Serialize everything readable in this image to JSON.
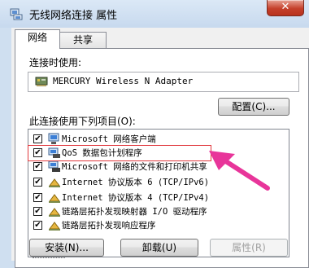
{
  "window": {
    "title": "无线网络连接 属性",
    "close_glyph": "✕"
  },
  "tabs": [
    {
      "label": "网络"
    },
    {
      "label": "共享"
    }
  ],
  "connect_using": {
    "label": "连接时使用:",
    "adapter": "MERCURY Wireless N Adapter",
    "icon": "network-adapter-icon"
  },
  "configure_button": "配置(C)...",
  "items_label": "此连接使用下列项目(O):",
  "items": [
    {
      "label": "Microsoft 网络客户端",
      "checked": true,
      "icon": "network-client-icon"
    },
    {
      "label": "QoS 数据包计划程序",
      "checked": true,
      "icon": "qos-scheduler-icon"
    },
    {
      "label": "Microsoft 网络的文件和打印机共享",
      "checked": true,
      "icon": "file-printer-sharing-icon"
    },
    {
      "label": "Internet 协议版本 6 (TCP/IPv6)",
      "checked": true,
      "icon": "protocol-icon",
      "highlighted": true
    },
    {
      "label": "Internet 协议版本 4 (TCP/IPv4)",
      "checked": true,
      "icon": "protocol-icon"
    },
    {
      "label": "链路层拓扑发现映射器 I/O 驱动程序",
      "checked": true,
      "icon": "protocol-icon"
    },
    {
      "label": "链路层拓扑发现响应程序",
      "checked": true,
      "icon": "protocol-icon"
    }
  ],
  "buttons": {
    "install": "安装(N)...",
    "uninstall": "卸载(U)",
    "properties": "属性(R)"
  },
  "annotation": {
    "color": "#e8359a",
    "highlight_color": "#e0393e"
  }
}
